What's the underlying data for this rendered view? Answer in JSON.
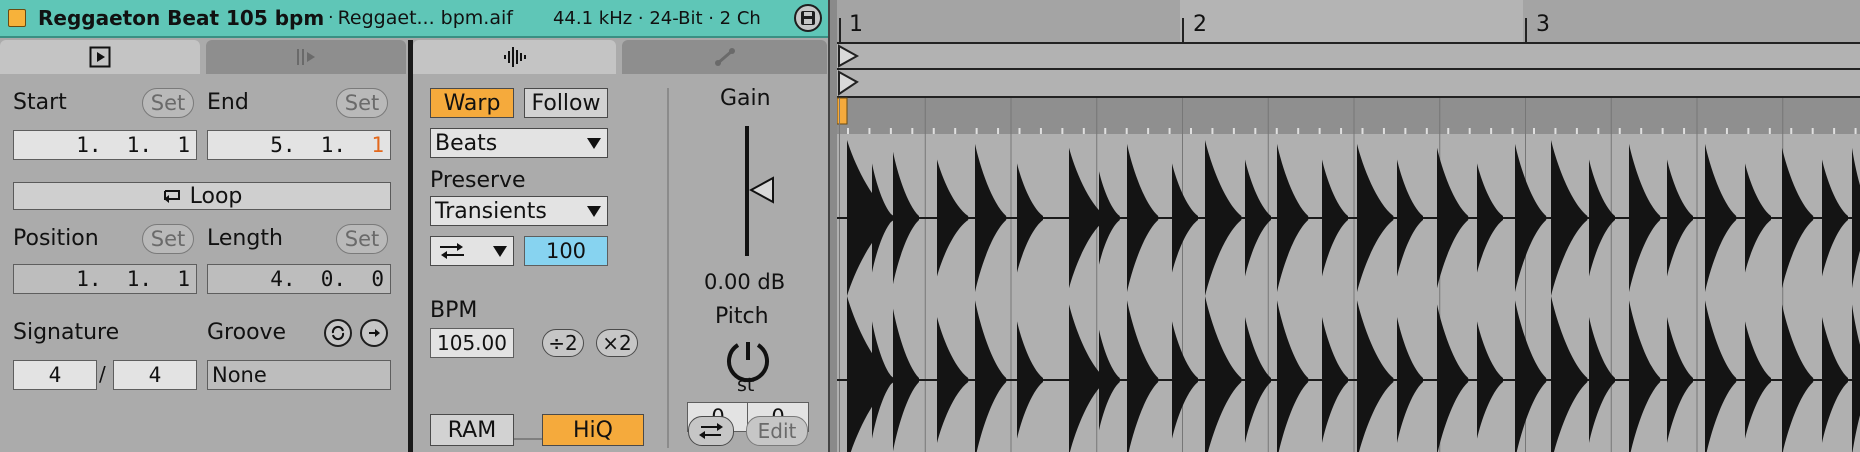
{
  "header": {
    "clip_name": "Reggaeton Beat 105 bpm",
    "separator": "·",
    "file_name": "Reggaet... bpm.aif",
    "sample_info": "44.1 kHz · 24-Bit · 2 Ch",
    "clip_color": "#f7b23a",
    "bar_color": "#5fc6b7"
  },
  "clip": {
    "start_label": "Start",
    "end_label": "End",
    "set_label": "Set",
    "start_value": "1.  1.  1",
    "end_value_main": "5.  1.  ",
    "end_value_highlight": "1",
    "loop_label": "Loop",
    "position_label": "Position",
    "length_label": "Length",
    "position_value": "1.  1.  1",
    "length_value": "4.  0.  0",
    "signature_label": "Signature",
    "sig_numerator": "4",
    "sig_slash": "/",
    "sig_denominator": "4",
    "groove_label": "Groove",
    "groove_value": "None"
  },
  "audio": {
    "warp_label": "Warp",
    "follow_label": "Follow",
    "warp_mode": "Beats",
    "preserve_label": "Preserve",
    "preserve_value": "Transients",
    "transient_loop_value": "100",
    "bpm_label": "BPM",
    "bpm_value": "105.00",
    "half_label": "÷2",
    "double_label": "×2",
    "ram_label": "RAM",
    "hiq_label": "HiQ",
    "gain_label": "Gain",
    "gain_value": "0.00 dB",
    "pitch_label": "Pitch",
    "pitch_unit": "st",
    "pitch_semitones": "0",
    "pitch_cents": "0",
    "edit_label": "Edit",
    "accent_on": "#f5aa3c",
    "accent_cyan": "#87d3f0"
  },
  "arrange": {
    "bar_numbers": [
      "1",
      "2",
      "3"
    ]
  }
}
